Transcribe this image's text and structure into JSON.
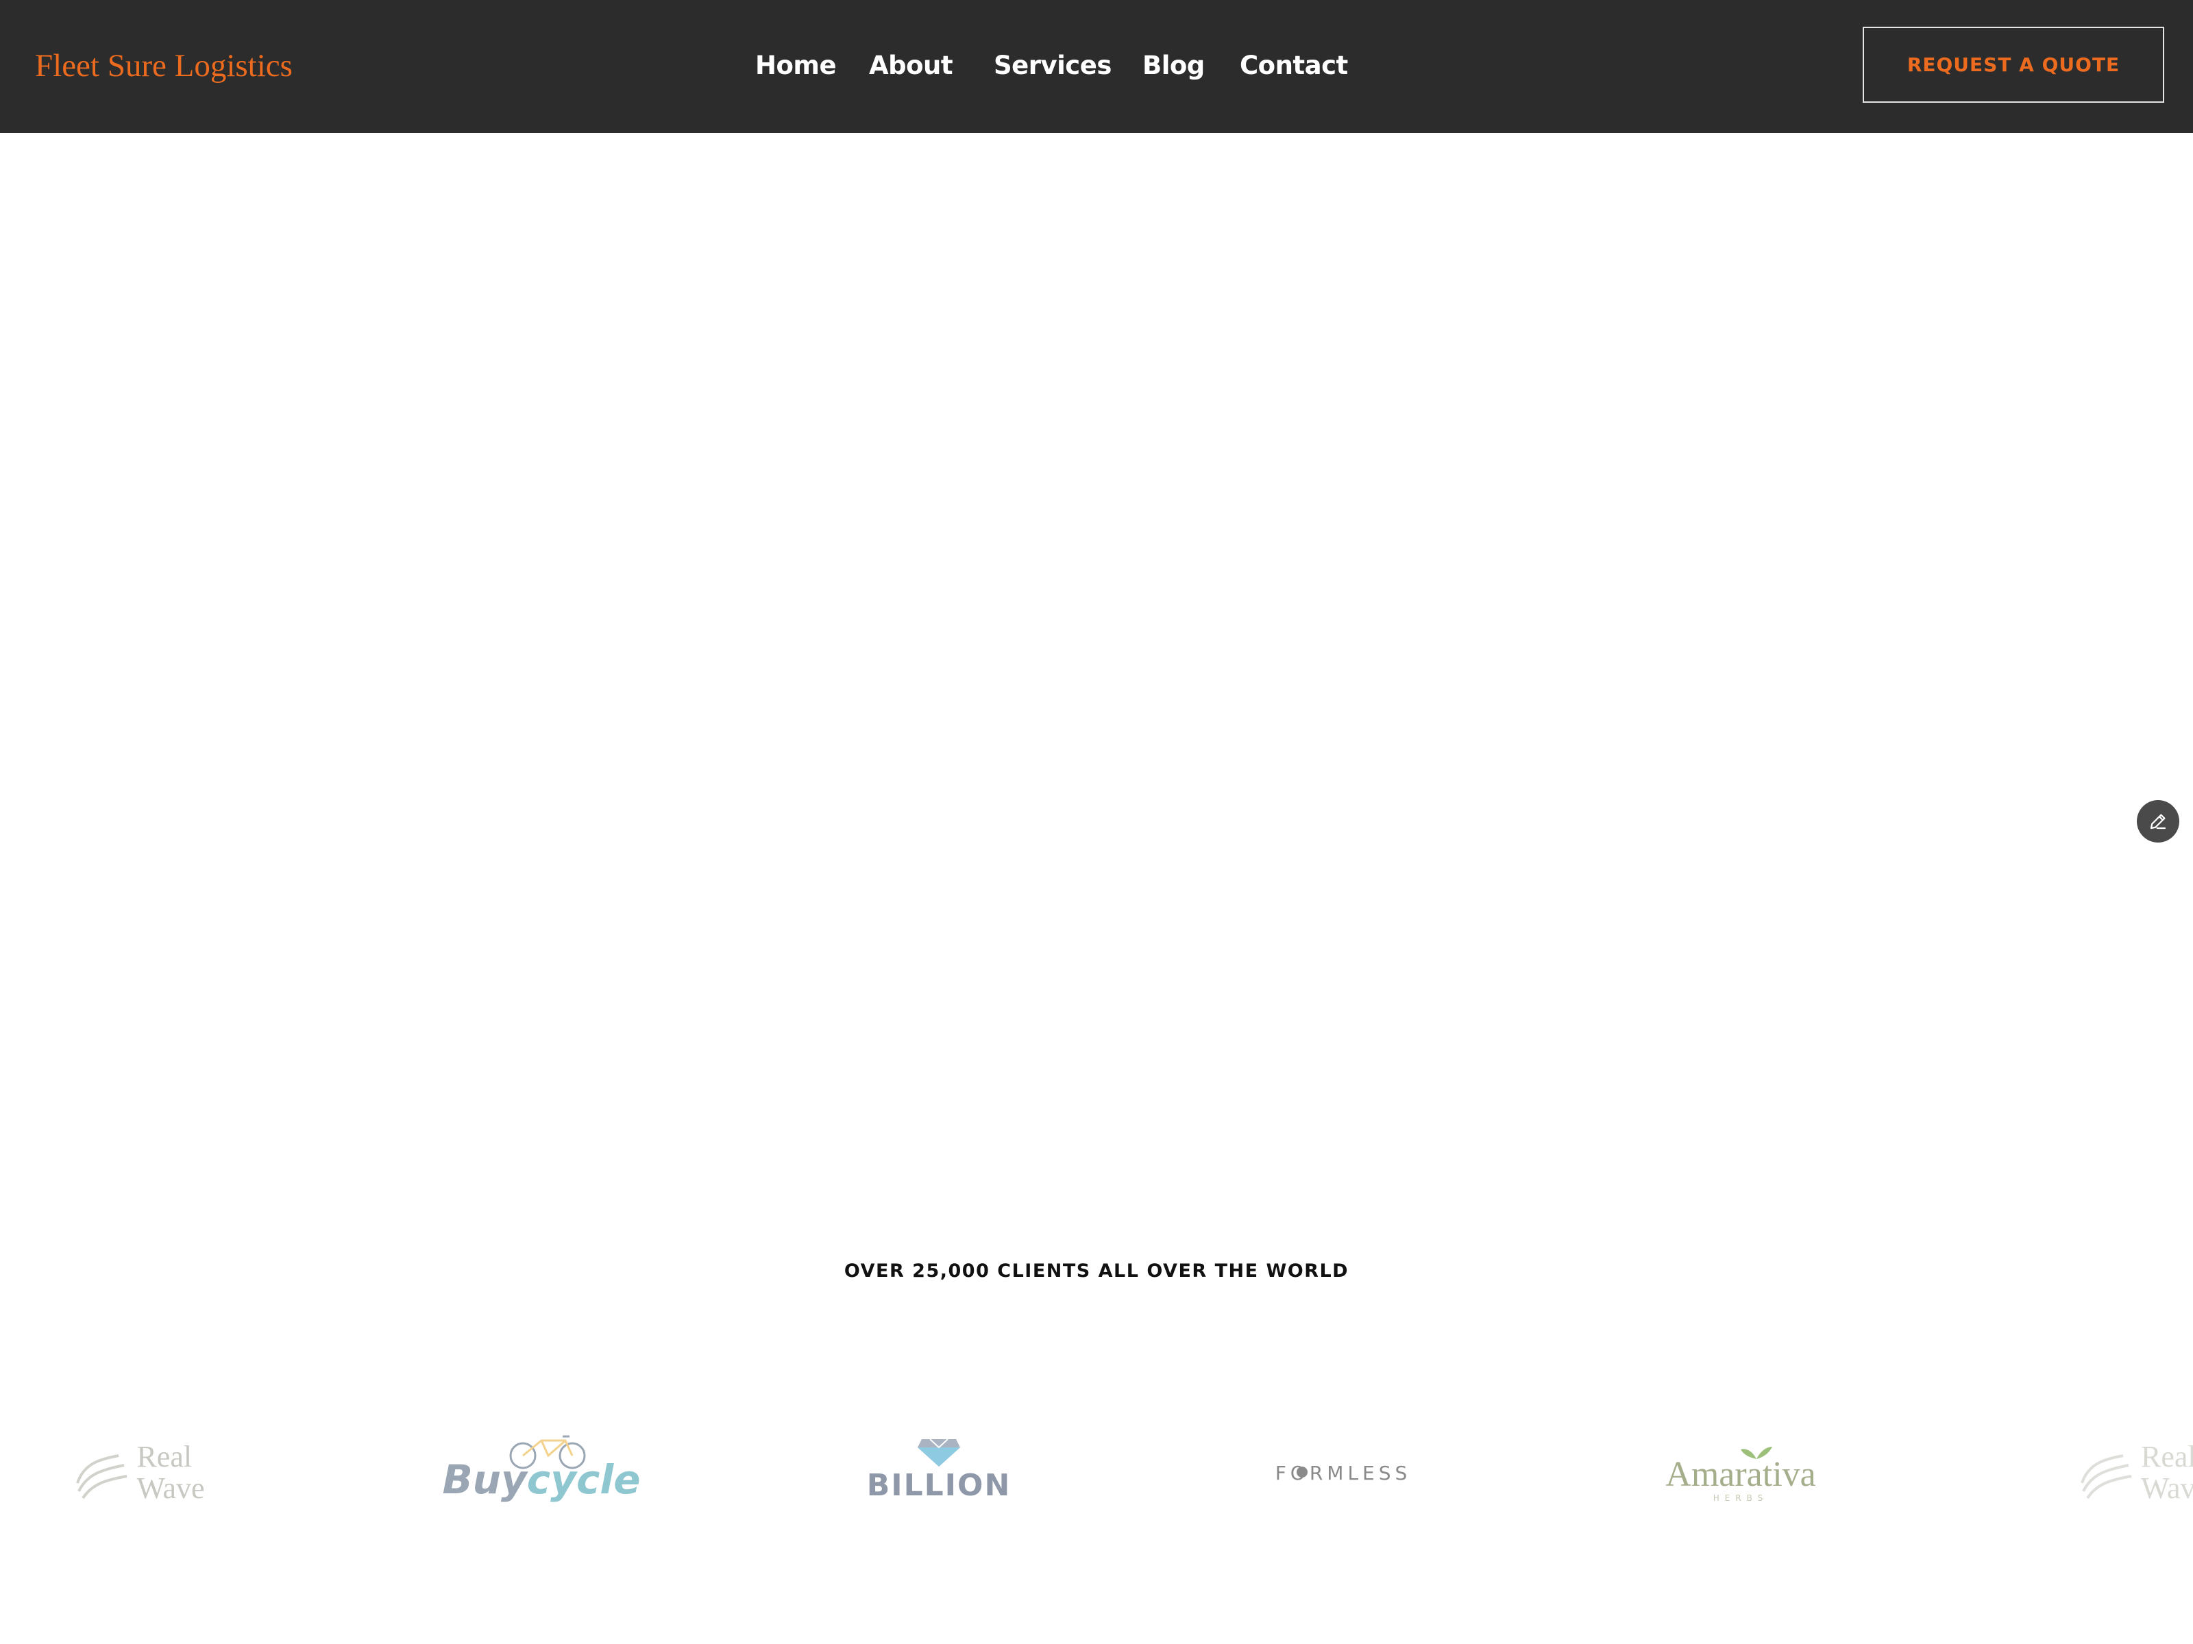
{
  "header": {
    "brand": "Fleet Sure Logistics",
    "nav": [
      "Home",
      "About",
      "Services",
      "Blog",
      "Contact"
    ],
    "cta": "REQUEST A QUOTE"
  },
  "clients": {
    "heading": "OVER 25,000 CLIENTS ALL OVER THE WORLD",
    "logos": [
      {
        "name": "realwave",
        "line1": "Real",
        "line2": "Wave",
        "icon": "wave-icon",
        "color": "#c8c8c2"
      },
      {
        "name": "buycycle",
        "part1": "Buy",
        "part2": "cycle",
        "icon": "bicycle-icon",
        "color1": "#9aa6b4",
        "color2": "#8ec7cf"
      },
      {
        "name": "billion",
        "text": "BILLION",
        "icon": "diamond-icon",
        "color": "#8f98a8"
      },
      {
        "name": "formless",
        "text": "FORMLESS",
        "icon": "dot-icon",
        "color": "#8a8a8a"
      },
      {
        "name": "amarativa",
        "text": "Amarativa",
        "sub": "HERBS",
        "icon": "leaf-icon",
        "color": "#a4ae8a"
      },
      {
        "name": "realwave-2",
        "line1": "Real",
        "line2": "Wave",
        "icon": "wave-icon",
        "color": "#d9d9d4"
      }
    ]
  },
  "colors": {
    "header_bg": "#2c2c2c",
    "accent": "#ec6b1f"
  }
}
